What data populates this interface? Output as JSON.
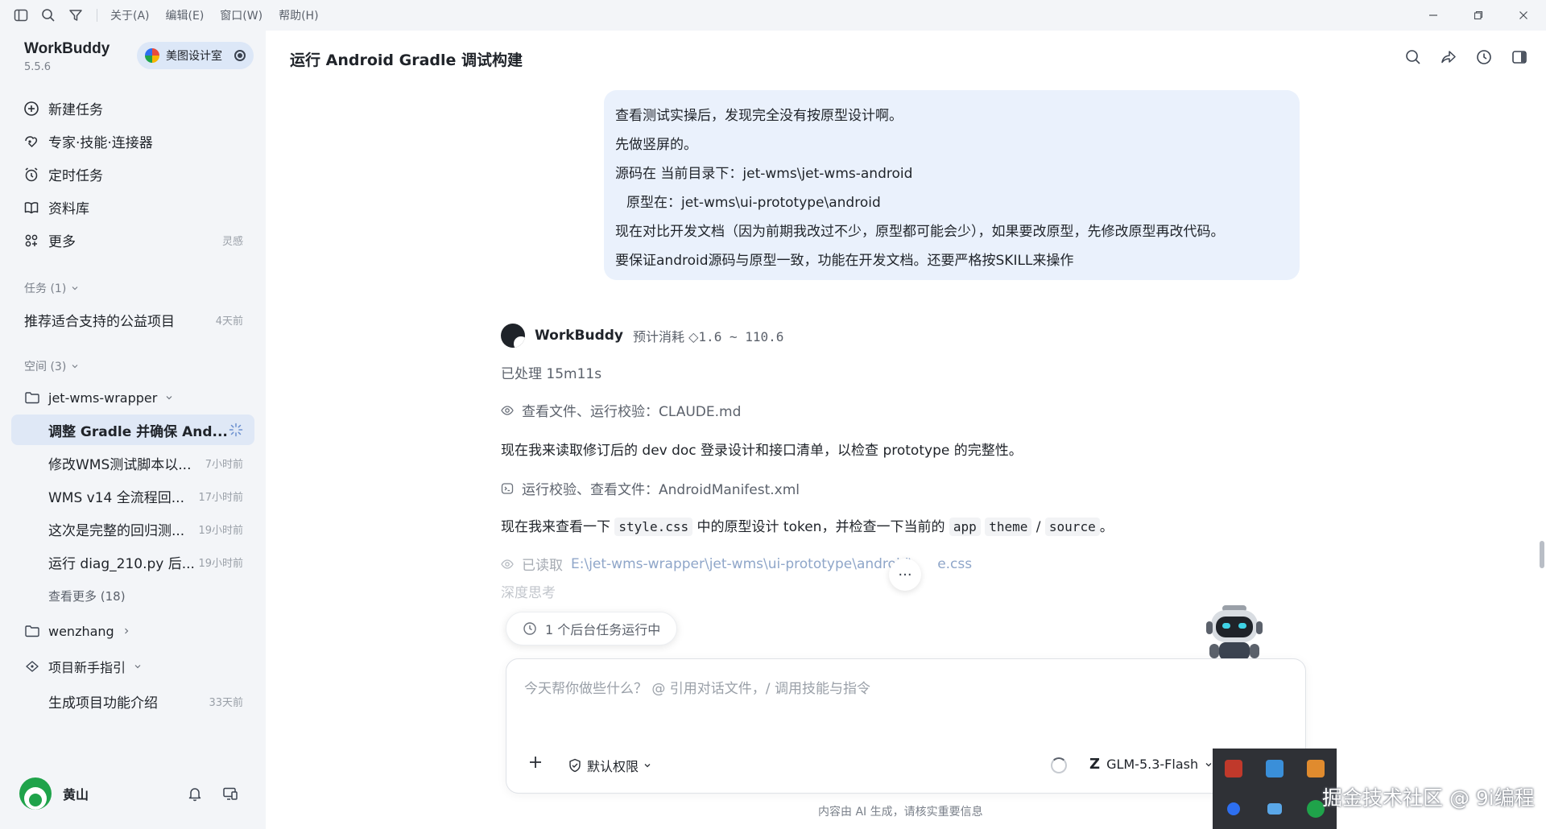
{
  "menubar": {
    "menus": [
      "关于(A)",
      "编辑(E)",
      "窗口(W)",
      "帮助(H)"
    ]
  },
  "brand": {
    "name": "WorkBuddy",
    "version": "5.5.6"
  },
  "workspace": {
    "label": "美图设计室"
  },
  "nav": [
    {
      "label": "新建任务",
      "icon": "plus-circle-icon"
    },
    {
      "label": "专家·技能·连接器",
      "icon": "expert-icon"
    },
    {
      "label": "定时任务",
      "icon": "alarm-icon"
    },
    {
      "label": "资料库",
      "icon": "book-icon"
    },
    {
      "label": "更多",
      "icon": "grid-icon",
      "hint": "灵感"
    }
  ],
  "tasks": {
    "title": "任务 (1)",
    "items": [
      {
        "label": "推荐适合支持的公益项目",
        "time": "4天前"
      }
    ]
  },
  "spaces": {
    "title": "空间 (3)",
    "groups": [
      {
        "name": "jet-wms-wrapper",
        "items": [
          {
            "label": "调整 Gradle 并确保 And...",
            "time": ""
          },
          {
            "label": "修改WMS测试脚本以...",
            "time": "7小时前"
          },
          {
            "label": "WMS v14 全流程回...",
            "time": "17小时前"
          },
          {
            "label": "这次是完整的回归测...",
            "time": "19小时前"
          },
          {
            "label": "运行 diag_210.py 后...",
            "time": "19小时前"
          }
        ],
        "more": "查看更多 (18)"
      },
      {
        "name": "wenzhang"
      },
      {
        "name": "项目新手指引",
        "items": [
          {
            "label": "生成项目功能介绍",
            "time": "33天前"
          }
        ]
      }
    ]
  },
  "user": {
    "name": "黄山"
  },
  "header": {
    "title": "运行 Android Gradle 调试构建"
  },
  "conversation": {
    "user_lines": [
      "查看测试实操后，发现完全没有按原型设计啊。",
      "先做竖屏的。",
      "源码在 当前目录下：jet-wms\\jet-wms-android",
      "原型在：jet-wms\\ui-prototype\\android",
      "现在对比开发文档（因为前期我改过不少，原型都可能会少），如果要改原型，先修改原型再改代码。",
      "要保证android源码与原型一致，功能在开发文档。还要严格按SKILL来操作"
    ],
    "bot_name": "WorkBuddy",
    "cost_label": "预计消耗",
    "cost_value": "1.6 ~ 110.6",
    "processed": "已处理 15m11s",
    "tool1": "查看文件、运行校验：CLAUDE.md",
    "msg1": "现在我来读取修订后的 dev doc 登录设计和接口清单，以检查 prototype 的完整性。",
    "tool2": "运行校验、查看文件：AndroidManifest.xml",
    "msg2_pre": "现在我来查看一下",
    "msg2_code1": "style.css",
    "msg2_mid": "中的原型设计 token，并检查一下当前的",
    "msg2_code2": "app",
    "msg2_code3": "theme",
    "msg2_slash": "/",
    "msg2_code4": "source",
    "msg2_end": "。",
    "tool3_label": "已读取",
    "tool3_path": "E:\\jet-wms-wrapper\\jet-wms\\ui-prototype\\android\\",
    "tool3_suffix": "e.css",
    "thinking": "深度思考",
    "dots": "···"
  },
  "background_task": "1 个后台任务运行中",
  "composer": {
    "placeholder": "今天帮你做些什么？ @ 引用对话文件，/ 调用技能与指令",
    "permission": "默认权限",
    "model": "GLM-5.3-Flash",
    "model_logo": "Z"
  },
  "disclaimer": "内容由 AI 生成，请核实重要信息",
  "watermark": "掘金技术社区 @ 9i编程"
}
